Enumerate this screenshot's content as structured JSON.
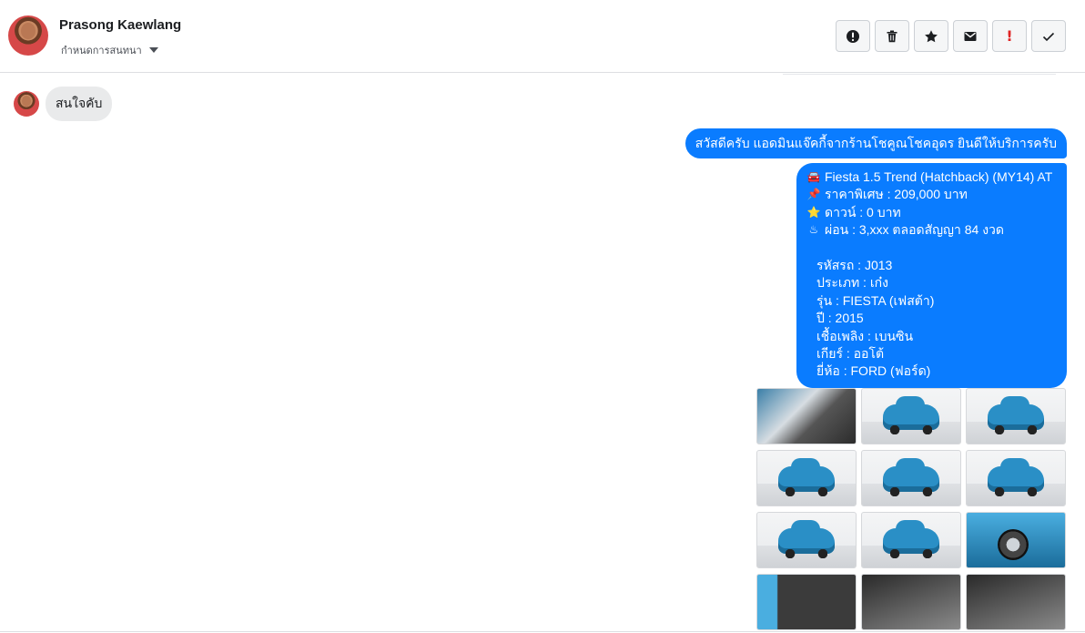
{
  "header": {
    "user_name": "Prasong Kaewlang",
    "assign_label": "กำหนดการสนทนา",
    "actions": [
      {
        "name": "mark-spam-button",
        "icon": "alert-circle-icon"
      },
      {
        "name": "delete-button",
        "icon": "trash-icon"
      },
      {
        "name": "star-button",
        "icon": "star-icon"
      },
      {
        "name": "mark-unread-button",
        "icon": "envelope-icon"
      },
      {
        "name": "mark-important-button",
        "icon": "exclamation-icon"
      },
      {
        "name": "mark-done-button",
        "icon": "checkmark-icon"
      }
    ]
  },
  "thread": {
    "incoming": [
      {
        "text": "สนใจคับ"
      }
    ],
    "outgoing_greeting": "สวัสดีครับ แอดมินแจ๊คกี้จากร้านโชคูณโชคอุดร ยินดีให้บริการครับ",
    "listing": {
      "title": "Fiesta 1.5 Trend (Hatchback) (MY14) AT",
      "title_icon": "🚘",
      "price": "ราคาพิเศษ : 209,000 บาท",
      "price_icon": "📌",
      "down": "ดาวน์ : 0 บาท",
      "down_icon": "⭐",
      "installment": "ผ่อน : 3,xxx ตลอดสัญญา 84 งวด",
      "installment_icon": "♨",
      "code": "รหัสรถ : J013",
      "type": "ประเภท : เก๋ง",
      "model": "รุ่น : FIESTA (เฟสต้า)",
      "year": "ปี : 2015",
      "fuel": "เชื้อเพลิง : เบนซิน",
      "gear": "เกียร์ : ออโต้",
      "brand": "ยี่ห้อ : FORD (ฟอร์ด)"
    },
    "photos": [
      {
        "kind": "engine"
      },
      {
        "kind": "front-left"
      },
      {
        "kind": "front"
      },
      {
        "kind": "front-right"
      },
      {
        "kind": "rear"
      },
      {
        "kind": "rear-left"
      },
      {
        "kind": "side-rear"
      },
      {
        "kind": "side"
      },
      {
        "kind": "wheel-closeup"
      },
      {
        "kind": "door-interior"
      },
      {
        "kind": "dashboard"
      },
      {
        "kind": "gear-console"
      }
    ]
  },
  "colors": {
    "outgoing_bubble": "#0a7cff",
    "incoming_bubble": "#e9eaeb",
    "important_red": "#e02424"
  }
}
